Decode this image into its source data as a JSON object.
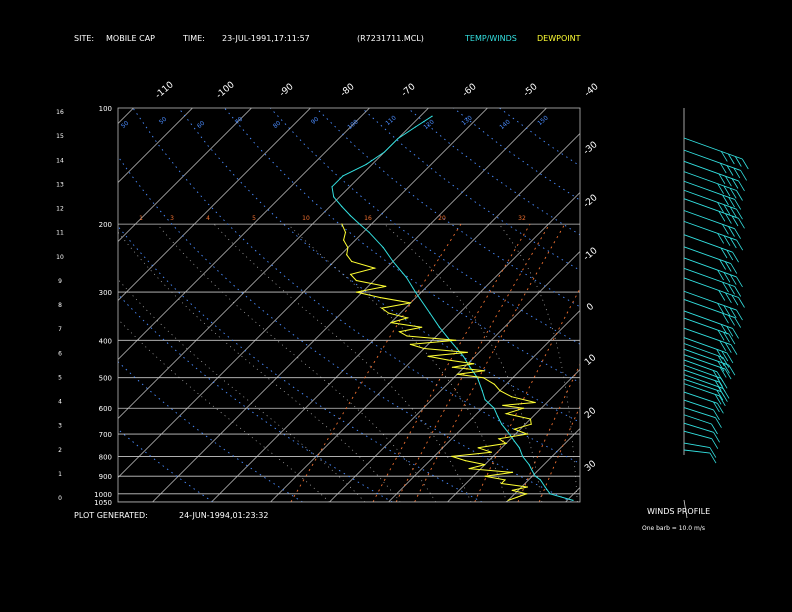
{
  "header": {
    "site_label": "SITE:",
    "site_value": "MOBILE CAP",
    "time_label": "TIME:",
    "time_value": "23-JUL-1991,17:11:57",
    "file_id": "(R7231711.MCL)",
    "legend_temp": "TEMP/WINDS",
    "legend_dew": "DEWPOINT"
  },
  "footer": {
    "generated_label": "PLOT GENERATED:",
    "generated_value": "24-JUN-1994,01:23:32"
  },
  "winds_panel": {
    "title": "WINDS PROFILE",
    "note": "One barb = 10.0 m/s"
  },
  "colors": {
    "temperature": "#33e0e0",
    "dewpoint": "#ffff33",
    "isotherm": "#c8c8c8",
    "isobar": "#c8c8c8",
    "dry_adiabat": "#4a8cff",
    "mixing_ratio": "#f07030",
    "moist_adiabat": "#bbbbbb"
  },
  "chart_data": {
    "type": "line",
    "y_scale": "log-pressure",
    "ylim": [
      1050,
      100
    ],
    "pressure_labels": [
      "100",
      "200",
      "300",
      "400",
      "500",
      "600",
      "700",
      "800",
      "900",
      "1000",
      "1050"
    ],
    "pressure_values": [
      100,
      200,
      300,
      400,
      500,
      600,
      700,
      800,
      900,
      1000,
      1050
    ],
    "height_km_labels": [
      "16",
      "15",
      "14",
      "13",
      "12",
      "11",
      "10",
      "9",
      "8",
      "7",
      "6",
      "5",
      "4",
      "3",
      "2",
      "1",
      "0"
    ],
    "skew_temp_labels_top": [
      "-110",
      "-100",
      "-90",
      "-80",
      "-70",
      "-60",
      "-50",
      "-40"
    ],
    "skew_temp_labels_right": [
      "-30",
      "-20",
      "-10",
      "0",
      "10",
      "20",
      "30"
    ],
    "mixing_ratio_labels": [
      "1",
      "3",
      "4",
      "5",
      "10",
      "16",
      "20",
      "32"
    ],
    "dry_adiabat_labels": [
      "50",
      "50",
      "60",
      "70",
      "80",
      "90",
      "100",
      "110",
      "120",
      "130",
      "140",
      "150"
    ],
    "series": [
      {
        "name": "TEMP/WINDS",
        "pressure": [
          1040,
          1000,
          960,
          920,
          900,
          870,
          840,
          800,
          760,
          730,
          700,
          660,
          630,
          600,
          570,
          540,
          500,
          470,
          440,
          400,
          370,
          340,
          300,
          275,
          250,
          230,
          210,
          200,
          190,
          180,
          170,
          160,
          150,
          140,
          130,
          120,
          112,
          105
        ],
        "temp": [
          31,
          26,
          24,
          22,
          20.5,
          19,
          17.5,
          15,
          13,
          11,
          9,
          6,
          4,
          2,
          -1,
          -3,
          -6,
          -9,
          -12,
          -17,
          -21,
          -25,
          -31,
          -35,
          -40,
          -44,
          -49,
          -52,
          -55,
          -58,
          -61,
          -63,
          -63,
          -61,
          -60,
          -60,
          -59,
          -58
        ]
      },
      {
        "name": "DEWPOINT",
        "pressure": [
          1040,
          1020,
          1000,
          980,
          960,
          940,
          920,
          900,
          880,
          860,
          840,
          820,
          800,
          780,
          760,
          740,
          720,
          700,
          680,
          660,
          640,
          620,
          600,
          590,
          580,
          560,
          540,
          520,
          500,
          490,
          480,
          470,
          460,
          450,
          440,
          430,
          420,
          410,
          400,
          390,
          380,
          370,
          360,
          350,
          340,
          330,
          320,
          310,
          300,
          290,
          280,
          270,
          260,
          250,
          240,
          230,
          220,
          210,
          200
        ],
        "temp": [
          20,
          21,
          22,
          19,
          21,
          16,
          16,
          12,
          16,
          8,
          10,
          6,
          3,
          9,
          6,
          10,
          8,
          12,
          9,
          11,
          10,
          5,
          7,
          3,
          8,
          3,
          0,
          -2,
          -5,
          -10,
          -6,
          -12,
          -9,
          -14,
          -18,
          -12,
          -20,
          -23,
          -16,
          -25,
          -27,
          -24,
          -30,
          -28,
          -32,
          -34,
          -30,
          -36,
          -41,
          -37,
          -43,
          -45,
          -42,
          -47,
          -49,
          -50,
          -52,
          -53,
          -55
        ]
      }
    ],
    "winds": [
      {
        "pressure": 1030,
        "speed_ms": 8,
        "dir": 200
      },
      {
        "pressure": 980,
        "speed_ms": 8,
        "dir": 210
      },
      {
        "pressure": 900,
        "speed_ms": 10,
        "dir": 230
      },
      {
        "pressure": 850,
        "speed_ms": 12,
        "dir": 240
      },
      {
        "pressure": 800,
        "speed_ms": 10,
        "dir": 250
      },
      {
        "pressure": 760,
        "speed_ms": 14,
        "dir": 245
      },
      {
        "pressure": 720,
        "speed_ms": 12,
        "dir": 250
      },
      {
        "pressure": 680,
        "speed_ms": 16,
        "dir": 250
      },
      {
        "pressure": 640,
        "speed_ms": 18,
        "dir": 255
      },
      {
        "pressure": 620,
        "speed_ms": 20,
        "dir": 250
      },
      {
        "pressure": 600,
        "speed_ms": 22,
        "dir": 260
      },
      {
        "pressure": 580,
        "speed_ms": 18,
        "dir": 255
      },
      {
        "pressure": 560,
        "speed_ms": 20,
        "dir": 265
      },
      {
        "pressure": 540,
        "speed_ms": 16,
        "dir": 270
      },
      {
        "pressure": 520,
        "speed_ms": 24,
        "dir": 260
      },
      {
        "pressure": 500,
        "speed_ms": 28,
        "dir": 265
      },
      {
        "pressure": 480,
        "speed_ms": 22,
        "dir": 270
      },
      {
        "pressure": 460,
        "speed_ms": 26,
        "dir": 265
      },
      {
        "pressure": 430,
        "speed_ms": 30,
        "dir": 260
      },
      {
        "pressure": 400,
        "speed_ms": 28,
        "dir": 265
      },
      {
        "pressure": 380,
        "speed_ms": 32,
        "dir": 270
      },
      {
        "pressure": 350,
        "speed_ms": 34,
        "dir": 265
      },
      {
        "pressure": 330,
        "speed_ms": 36,
        "dir": 270
      },
      {
        "pressure": 300,
        "speed_ms": 38,
        "dir": 270
      },
      {
        "pressure": 280,
        "speed_ms": 34,
        "dir": 265
      },
      {
        "pressure": 260,
        "speed_ms": 36,
        "dir": 270
      },
      {
        "pressure": 240,
        "speed_ms": 30,
        "dir": 265
      },
      {
        "pressure": 220,
        "speed_ms": 32,
        "dir": 270
      },
      {
        "pressure": 200,
        "speed_ms": 36,
        "dir": 265
      },
      {
        "pressure": 185,
        "speed_ms": 34,
        "dir": 270
      },
      {
        "pressure": 170,
        "speed_ms": 38,
        "dir": 268
      },
      {
        "pressure": 160,
        "speed_ms": 36,
        "dir": 270
      },
      {
        "pressure": 150,
        "speed_ms": 34,
        "dir": 265
      },
      {
        "pressure": 140,
        "speed_ms": 36,
        "dir": 270
      },
      {
        "pressure": 130,
        "speed_ms": 38,
        "dir": 268
      },
      {
        "pressure": 120,
        "speed_ms": 40,
        "dir": 265
      },
      {
        "pressure": 110,
        "speed_ms": 42,
        "dir": 270
      }
    ]
  }
}
